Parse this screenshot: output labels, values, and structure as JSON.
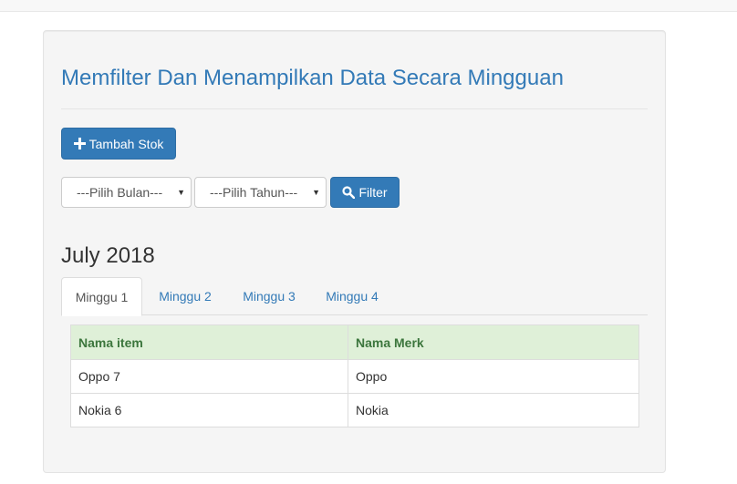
{
  "title": "Memfilter Dan Menampilkan Data Secara Mingguan",
  "add_button": {
    "label": "Tambah Stok",
    "icon": "plus-icon"
  },
  "filters": {
    "month_select": "---Pilih Bulan---",
    "year_select": "---Pilih Tahun---",
    "filter_button": {
      "label": "Filter",
      "icon": "search-icon"
    }
  },
  "period_heading": "July 2018",
  "tabs": [
    {
      "label": "Minggu 1",
      "active": true
    },
    {
      "label": "Minggu 2",
      "active": false
    },
    {
      "label": "Minggu 3",
      "active": false
    },
    {
      "label": "Minggu 4",
      "active": false
    }
  ],
  "table": {
    "headers": [
      "Nama item",
      "Nama Merk"
    ],
    "rows": [
      [
        "Oppo 7",
        "Oppo"
      ],
      [
        "Nokia 6",
        "Nokia"
      ]
    ]
  },
  "colors": {
    "primary": "#337ab7",
    "header_bg": "#dff0d8",
    "header_text": "#3c763d",
    "well_bg": "#f5f5f5"
  }
}
